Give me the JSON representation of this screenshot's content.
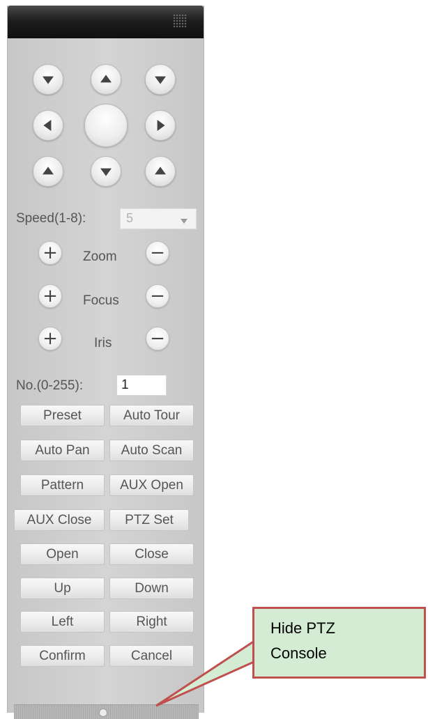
{
  "ptz": {
    "speed_label": "Speed(1-8):",
    "speed_value": "5",
    "zoom_label": "Zoom",
    "focus_label": "Focus",
    "iris_label": "Iris",
    "plus_glyph": "+",
    "minus_glyph": "−",
    "number_label": "No.(0-255):",
    "number_value": "1",
    "buttons": {
      "preset": "Preset",
      "auto_tour": "Auto Tour",
      "auto_pan": "Auto Pan",
      "auto_scan": "Auto Scan",
      "pattern": "Pattern",
      "aux_open": "AUX Open",
      "aux_close": "AUX Close",
      "ptz_set": "PTZ Set",
      "open": "Open",
      "close": "Close",
      "up": "Up",
      "down": "Down",
      "left": "Left",
      "right": "Right",
      "confirm": "Confirm",
      "cancel": "Cancel"
    }
  },
  "callout": {
    "line1": "Hide PTZ",
    "line2": "Console",
    "border_color": "#c0504d",
    "fill_color": "#d3ecd3"
  }
}
